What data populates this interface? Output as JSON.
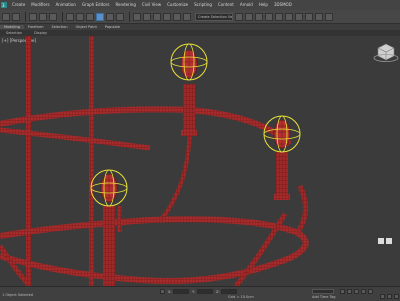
{
  "menu": {
    "items": [
      "Create",
      "Modifiers",
      "Animation",
      "Graph Editors",
      "Rendering",
      "Civil View",
      "Customize",
      "Scripting",
      "Content",
      "Arnold",
      "Help",
      "3DSMOD"
    ]
  },
  "toolbar": {
    "selection_set_placeholder": "Create Selection Se"
  },
  "ribbon": {
    "tabs": [
      "Modeling",
      "Freeform",
      "Selection",
      "Object Paint",
      "Populate"
    ],
    "active_tab": "Modeling",
    "row2": [
      "Selection",
      "Display"
    ]
  },
  "viewport": {
    "label": "[+] [Perspective]"
  },
  "status": {
    "left_text": "1 Object Selected",
    "x_label": "X:",
    "y_label": "Y:",
    "z_label": "Z:",
    "grid_text": "Grid = 10.0cm",
    "time_tag": "Add Time Tag"
  },
  "colors": {
    "ui_dark": "#3b3b3b",
    "mesh_red": "#9c2a2a",
    "mesh_outline": "#5a0f0f",
    "gizmo_yellow": "#e9e23a",
    "accent_blue": "#5b8fc7"
  }
}
